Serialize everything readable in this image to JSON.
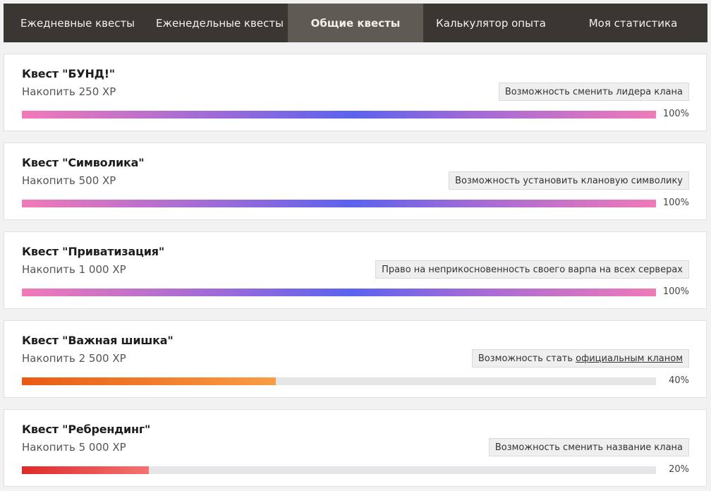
{
  "tabs": [
    {
      "label": "Ежедневные квесты",
      "active": false
    },
    {
      "label": "Еженедельные квесты",
      "active": false
    },
    {
      "label": "Общие квесты",
      "active": true
    },
    {
      "label": "Калькулятор опыта",
      "active": false
    },
    {
      "label": "Моя статистика",
      "active": false
    }
  ],
  "quests": [
    {
      "title": "Квест \"БУНД!\"",
      "desc": "Накопить 250 XP",
      "reward": "Возможность сменить лидера клана",
      "progress": 100,
      "progress_label": "100%",
      "bar_style": "rainbow"
    },
    {
      "title": "Квест \"Символика\"",
      "desc": "Накопить 500 XP",
      "reward": "Возможность установить клановую символику",
      "progress": 100,
      "progress_label": "100%",
      "bar_style": "rainbow"
    },
    {
      "title": "Квест \"Приватизация\"",
      "desc": "Накопить 1 000 XP",
      "reward": "Право на неприкосновенность своего варпа на всех серверах",
      "progress": 100,
      "progress_label": "100%",
      "bar_style": "rainbow"
    },
    {
      "title": "Квест \"Важная шишка\"",
      "desc": "Накопить 2 500 XP",
      "reward_prefix": "Возможность стать ",
      "reward_link": "официальным кланом",
      "progress": 40,
      "progress_label": "40%",
      "bar_style": "orange"
    },
    {
      "title": "Квест \"Ребрендинг\"",
      "desc": "Накопить 5 000 XP",
      "reward": "Возможность сменить название клана",
      "progress": 20,
      "progress_label": "20%",
      "bar_style": "red"
    }
  ],
  "colors": {
    "tab_bar": "#3a3631",
    "tab_active": "#5f5a53",
    "bar_track": "#e6e6e9",
    "bar_orange": "#ea5a10",
    "bar_red": "#df2a2a"
  }
}
